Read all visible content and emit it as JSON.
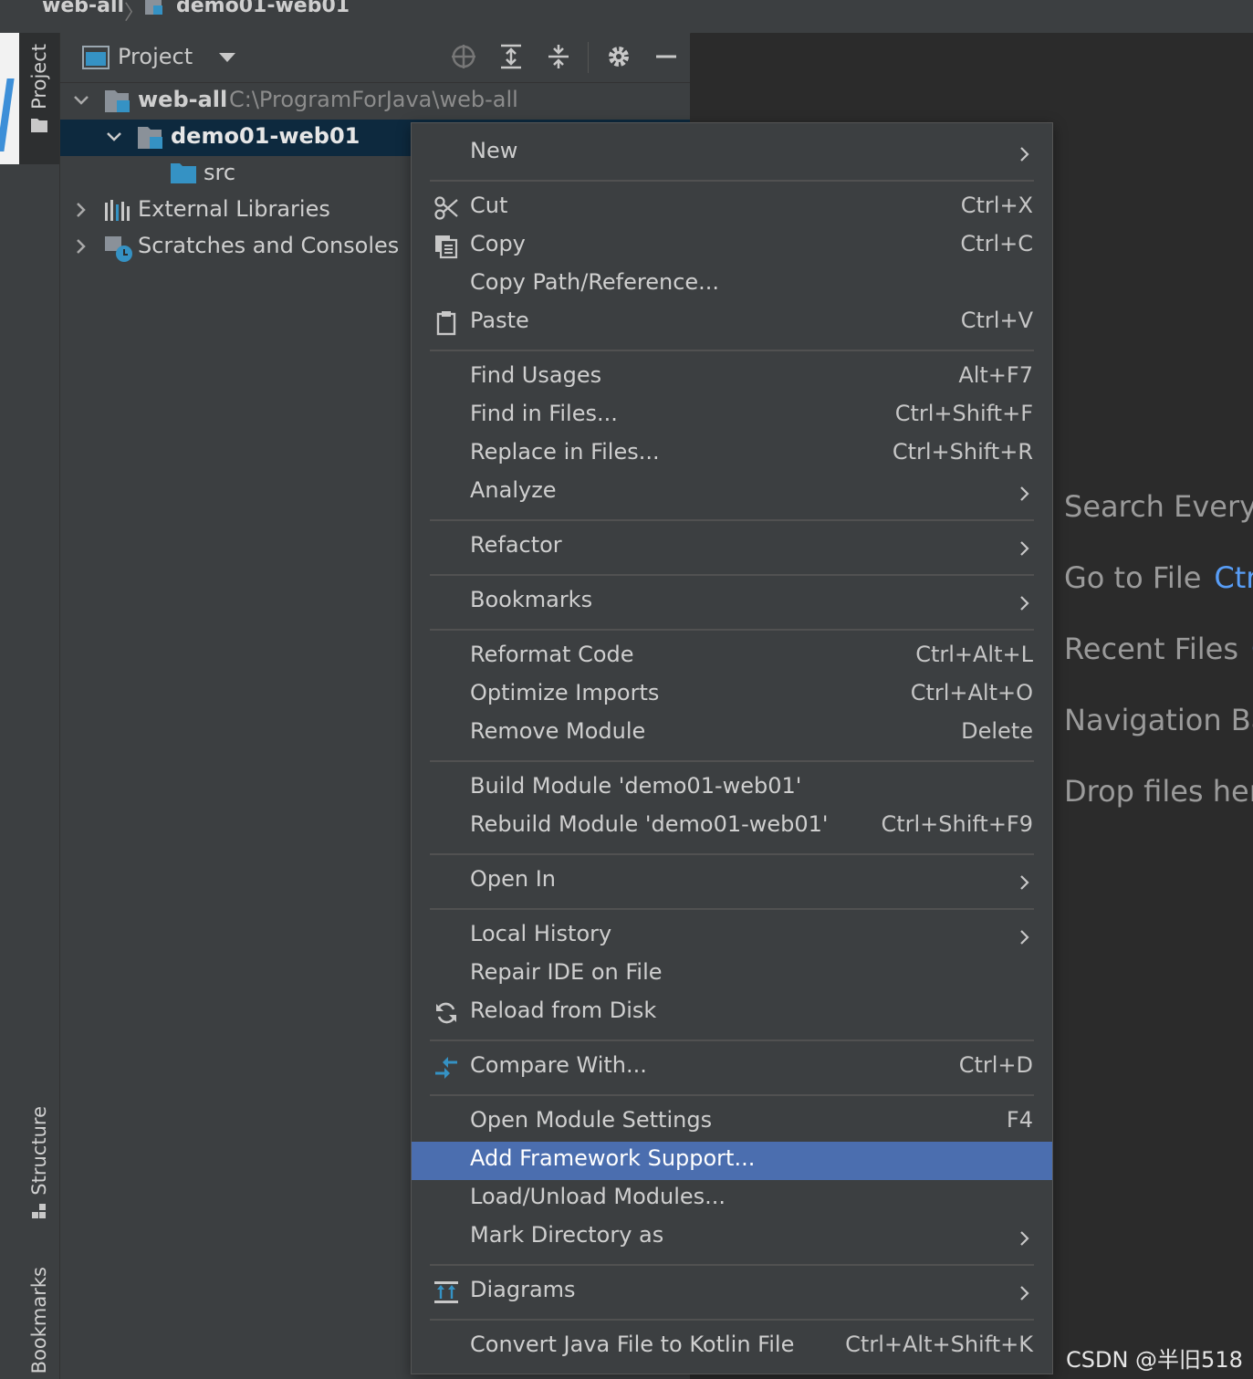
{
  "breadcrumb": {
    "root": "web-all",
    "module": "demo01-web01"
  },
  "tool_strip": {
    "project_tab": "Project",
    "structure_tab": "Structure",
    "bookmarks_tab": "Bookmarks"
  },
  "project_panel": {
    "title": "Project",
    "tree": {
      "root_label": "web-all",
      "root_path": "C:\\ProgramForJava\\web-all",
      "module_label": "demo01-web01",
      "src_label": "src",
      "external_libraries": "External Libraries",
      "scratches": "Scratches and Consoles"
    }
  },
  "context_menu": {
    "new": "New",
    "cut": "Cut",
    "cut_shortcut": "Ctrl+X",
    "copy": "Copy",
    "copy_shortcut": "Ctrl+C",
    "copy_path": "Copy Path/Reference...",
    "paste": "Paste",
    "paste_shortcut": "Ctrl+V",
    "find_usages": "Find Usages",
    "find_usages_shortcut": "Alt+F7",
    "find_in_files": "Find in Files...",
    "find_in_files_shortcut": "Ctrl+Shift+F",
    "replace_in_files": "Replace in Files...",
    "replace_in_files_shortcut": "Ctrl+Shift+R",
    "analyze": "Analyze",
    "refactor": "Refactor",
    "bookmarks": "Bookmarks",
    "reformat_code": "Reformat Code",
    "reformat_code_shortcut": "Ctrl+Alt+L",
    "optimize_imports": "Optimize Imports",
    "optimize_imports_shortcut": "Ctrl+Alt+O",
    "remove_module": "Remove Module",
    "remove_module_shortcut": "Delete",
    "build_module": "Build Module 'demo01-web01'",
    "rebuild_module": "Rebuild Module 'demo01-web01'",
    "rebuild_module_shortcut": "Ctrl+Shift+F9",
    "open_in": "Open In",
    "local_history": "Local History",
    "repair_ide": "Repair IDE on File",
    "reload_from_disk": "Reload from Disk",
    "compare_with": "Compare With...",
    "compare_with_shortcut": "Ctrl+D",
    "open_module_settings": "Open Module Settings",
    "open_module_settings_shortcut": "F4",
    "add_framework_support": "Add Framework Support...",
    "load_unload_modules": "Load/Unload Modules...",
    "mark_directory_as": "Mark Directory as",
    "diagrams": "Diagrams",
    "convert_java_to_kotlin": "Convert Java File to Kotlin File",
    "convert_java_to_kotlin_shortcut": "Ctrl+Alt+Shift+K"
  },
  "editor_hints": {
    "search_everywhere": "Search Everyw",
    "go_to_file": "Go to File",
    "go_to_file_key": "Ctr",
    "recent_files": "Recent Files",
    "recent_files_key": "C",
    "navigation_bar": "Navigation Ba",
    "drop_files": "Drop files her"
  },
  "watermark": "CSDN @半旧518",
  "colors": {
    "selection": "#4b6eaf",
    "tree_selection": "#0d293e",
    "key_blue": "#589df6",
    "folder_blue": "#3592c4"
  }
}
